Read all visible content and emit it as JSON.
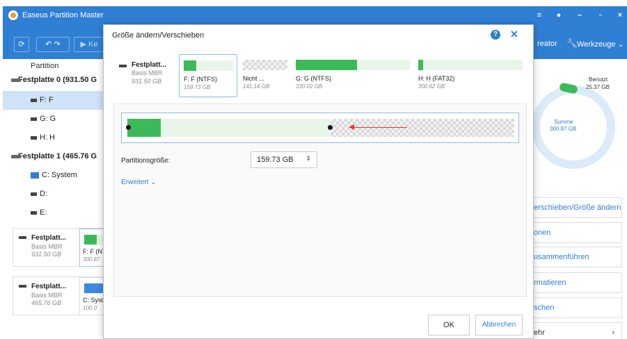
{
  "window": {
    "title": "Easeus Partition Master"
  },
  "toolbar": {
    "creator_label": "reator",
    "tools_label": "Werkzeuge ⌄",
    "execute_label": "Ke"
  },
  "tree": {
    "header": "Partition",
    "disk0": "Festplatte 0 (931.50 G",
    "disk0_parts": [
      "F: F",
      "G: G",
      "H: H"
    ],
    "disk1": "Festplatte 1 (465.76 G",
    "disk1_parts": [
      "C: System",
      "D:",
      "E:"
    ]
  },
  "cards": [
    {
      "name": "Festplatt...",
      "type": "Basis MBR",
      "size": "931.50 GB",
      "part_label": "F: F (NT",
      "part_size": "300.87",
      "bar_color": "#3cba5a"
    },
    {
      "name": "Festplatt...",
      "type": "Basis MBR",
      "size": "465.76 GB",
      "part_label": "C: Syst",
      "part_size": "100.0",
      "bar_color": "#3d8ae0"
    }
  ],
  "right": {
    "used_label": "Benutzt",
    "used_value": "25.37 GB",
    "sum_label": "Summe",
    "sum_value": "300.87 GB",
    "actions": [
      "erschieben/Größe ändern",
      "onen",
      "usammenführen",
      "rmatieren",
      "schen",
      "ehr"
    ]
  },
  "modal": {
    "title": "Größe ändern/Verschieben",
    "disk": {
      "name": "Festplatt...",
      "type": "Basis MBR",
      "size": "931.50 GB"
    },
    "partitions": [
      {
        "label": "F: F (NTFS)",
        "size": "159.73 GB"
      },
      {
        "label": "Nicht ...",
        "size": "141.14 GB"
      },
      {
        "label": "G: G (NTFS)",
        "size": "330.02 GB"
      },
      {
        "label": "H: H (FAT32)",
        "size": "300.62 GB"
      }
    ],
    "partition_size_label": "Partitionsgröße:",
    "partition_size_value": "159.73 GB",
    "advanced_label": "Erweitert ⌄",
    "ok_label": "OK",
    "cancel_label": "Abbrechen"
  },
  "colors": {
    "accent": "#2f7fd4",
    "used": "#3cba5a",
    "free": "#e8f6ea"
  }
}
